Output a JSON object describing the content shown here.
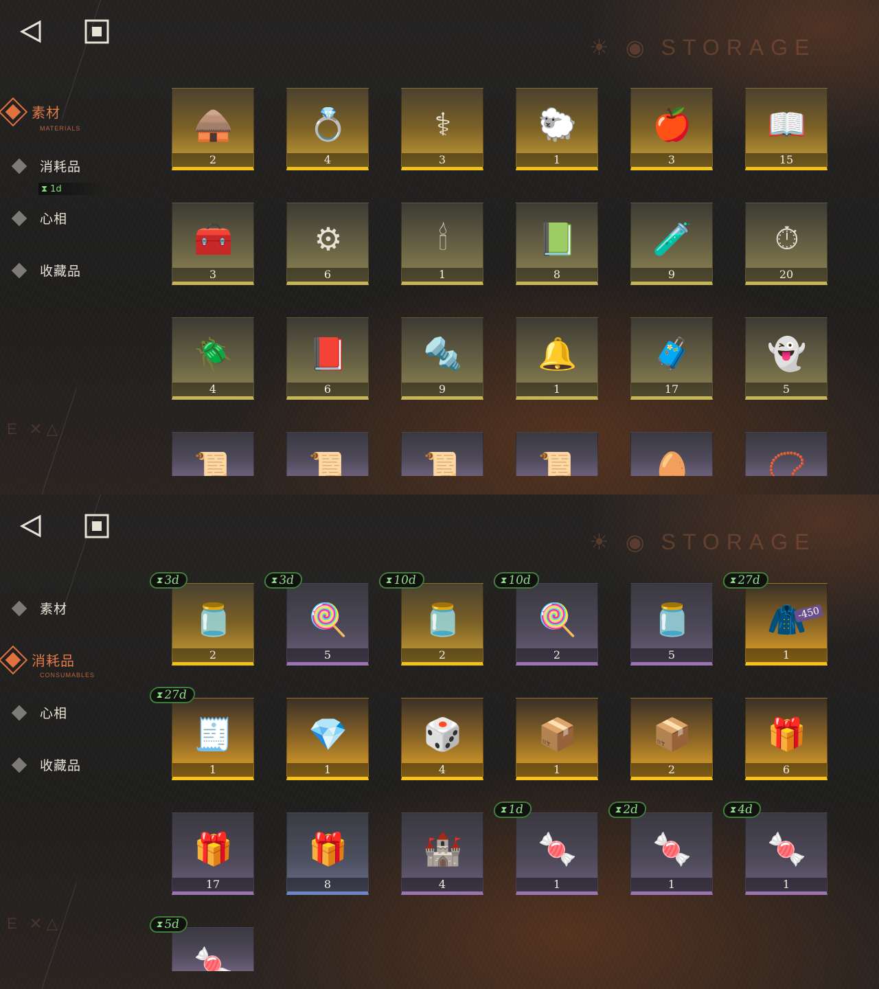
{
  "header": {
    "title": "STORAGE",
    "back_icon": "back-arrow-icon",
    "home_icon": "square-stop-icon"
  },
  "colors": {
    "accent": "#e0723f",
    "timer_green": "#7fdc79",
    "gold_border": "#f1c21a",
    "purple_border": "#9b74b4",
    "blue_border": "#6f86c4"
  },
  "top_panel": {
    "nav": {
      "materials": {
        "label": "素材",
        "sub": "MATERIALS"
      },
      "consumables": {
        "label": "消耗品",
        "timer": "1d"
      },
      "mind": {
        "label": "心相"
      },
      "collectibles": {
        "label": "收藏品"
      }
    },
    "items": [
      {
        "name": "haunted-cabin",
        "icon": "🛖",
        "count": "2",
        "rarity": "gold"
      },
      {
        "name": "golden-ring",
        "icon": "💍",
        "count": "4",
        "rarity": "gold"
      },
      {
        "name": "winged-caduceus",
        "icon": "⚕",
        "count": "3",
        "rarity": "gold"
      },
      {
        "name": "golden-sheep",
        "icon": "🐑",
        "count": "1",
        "rarity": "gold"
      },
      {
        "name": "serpent-apple",
        "icon": "🍎",
        "count": "3",
        "rarity": "gold"
      },
      {
        "name": "open-book",
        "icon": "📖",
        "count": "15",
        "rarity": "gold"
      },
      {
        "name": "root-chest",
        "icon": "🧰",
        "count": "3",
        "rarity": "dim"
      },
      {
        "name": "astrolabe",
        "icon": "⚙",
        "count": "6",
        "rarity": "dim"
      },
      {
        "name": "ouija-board",
        "icon": "🕯",
        "count": "1",
        "rarity": "dim"
      },
      {
        "name": "green-tablet",
        "icon": "📗",
        "count": "8",
        "rarity": "dim"
      },
      {
        "name": "purple-potion",
        "icon": "🧪",
        "count": "9",
        "rarity": "dim"
      },
      {
        "name": "pocket-watch",
        "icon": "⏱",
        "count": "20",
        "rarity": "dim"
      },
      {
        "name": "firefly",
        "icon": "🪲",
        "count": "4",
        "rarity": "dim"
      },
      {
        "name": "leather-tome",
        "icon": "📕",
        "count": "6",
        "rarity": "dim"
      },
      {
        "name": "silver-bullets",
        "icon": "🔩",
        "count": "9",
        "rarity": "dim"
      },
      {
        "name": "bell-jar",
        "icon": "🔔",
        "count": "1",
        "rarity": "dim"
      },
      {
        "name": "hand-box",
        "icon": "🧳",
        "count": "17",
        "rarity": "dim"
      },
      {
        "name": "ghost-sheet",
        "icon": "👻",
        "count": "5",
        "rarity": "dim"
      },
      {
        "name": "scroll-red",
        "icon": "📜",
        "count": "",
        "rarity": "purple"
      },
      {
        "name": "scroll-green",
        "icon": "📜",
        "count": "",
        "rarity": "purple"
      },
      {
        "name": "scroll-blue",
        "icon": "📜",
        "count": "",
        "rarity": "purple"
      },
      {
        "name": "scroll-orange",
        "icon": "📜",
        "count": "",
        "rarity": "purple"
      },
      {
        "name": "heart-egg",
        "icon": "🥚",
        "count": "",
        "rarity": "purple"
      },
      {
        "name": "amulet",
        "icon": "📿",
        "count": "",
        "rarity": "purple"
      }
    ]
  },
  "bottom_panel": {
    "nav": {
      "materials": {
        "label": "素材"
      },
      "consumables": {
        "label": "消耗品",
        "sub": "CONSUMABLES"
      },
      "mind": {
        "label": "心相"
      },
      "collectibles": {
        "label": "收藏品"
      }
    },
    "items": [
      {
        "name": "candy-jar",
        "icon": "🫙",
        "count": "2",
        "rarity": "gold",
        "expire": "3d"
      },
      {
        "name": "lollipops",
        "icon": "🍭",
        "count": "5",
        "rarity": "purple",
        "expire": "3d"
      },
      {
        "name": "candy-jar",
        "icon": "🫙",
        "count": "2",
        "rarity": "gold",
        "expire": "10d"
      },
      {
        "name": "lollipops",
        "icon": "🍭",
        "count": "2",
        "rarity": "purple",
        "expire": "10d"
      },
      {
        "name": "candy-jar",
        "icon": "🫙",
        "count": "5",
        "rarity": "purple",
        "expire": ""
      },
      {
        "name": "tailor-mannequin",
        "icon": "🧥",
        "count": "1",
        "rarity": "brightgold",
        "expire": "27d",
        "tag": "-450"
      },
      {
        "name": "shopping-list",
        "icon": "🧾",
        "count": "1",
        "rarity": "brightgold",
        "expire": "27d"
      },
      {
        "name": "crystal-shard",
        "icon": "💎",
        "count": "1",
        "rarity": "brightgold",
        "expire": ""
      },
      {
        "name": "rune-crate",
        "icon": "🎲",
        "count": "4",
        "rarity": "brightgold",
        "expire": ""
      },
      {
        "name": "wooden-crate",
        "icon": "📦",
        "count": "1",
        "rarity": "brightgold",
        "expire": ""
      },
      {
        "name": "wooden-crate",
        "icon": "📦",
        "count": "2",
        "rarity": "brightgold",
        "expire": ""
      },
      {
        "name": "parcel",
        "icon": "🎁",
        "count": "6",
        "rarity": "brightgold",
        "expire": ""
      },
      {
        "name": "parcel",
        "icon": "🎁",
        "count": "17",
        "rarity": "purple",
        "expire": ""
      },
      {
        "name": "parcel",
        "icon": "🎁",
        "count": "8",
        "rarity": "blue",
        "expire": ""
      },
      {
        "name": "sand-castle",
        "icon": "🏰",
        "count": "4",
        "rarity": "purple",
        "expire": ""
      },
      {
        "name": "wrapped-candy",
        "icon": "🍬",
        "count": "1",
        "rarity": "purple",
        "expire": "1d"
      },
      {
        "name": "wrapped-candy",
        "icon": "🍬",
        "count": "1",
        "rarity": "purple",
        "expire": "2d"
      },
      {
        "name": "wrapped-candy",
        "icon": "🍬",
        "count": "1",
        "rarity": "purple",
        "expire": "4d"
      },
      {
        "name": "wrapped-candy",
        "icon": "🍬",
        "count": "",
        "rarity": "purple",
        "expire": "5d"
      }
    ]
  }
}
